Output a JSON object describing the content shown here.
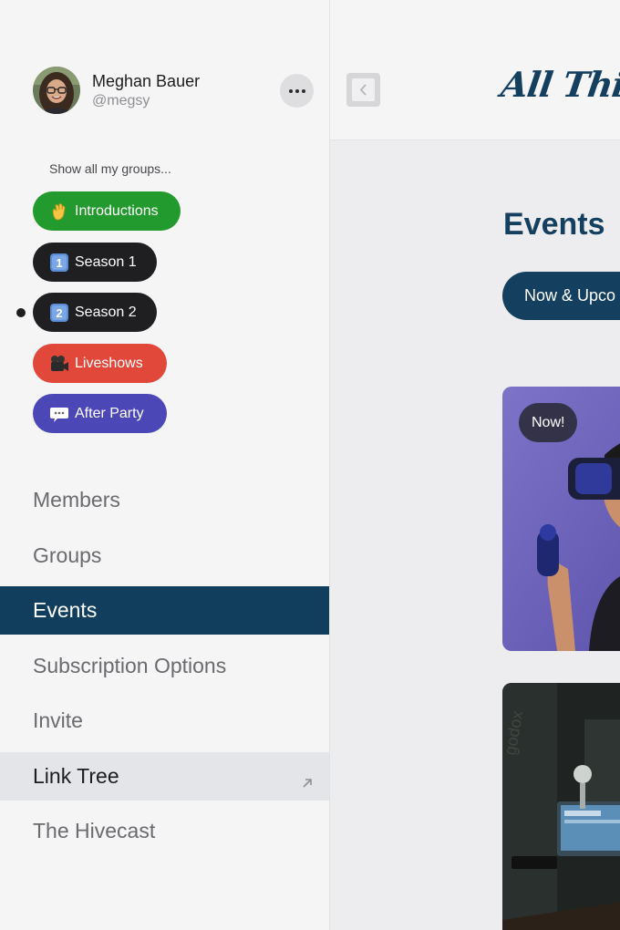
{
  "profile": {
    "name": "Meghan Bauer",
    "handle": "@megsy"
  },
  "groups": {
    "show_all_label": "Show all my groups...",
    "items": [
      {
        "label": "Introductions",
        "icon": "waving-hand-icon",
        "color": "#229a2d"
      },
      {
        "label": "Season 1",
        "icon": "keycap-1-icon",
        "color": "#1f1f22"
      },
      {
        "label": "Season 2",
        "icon": "keycap-2-icon",
        "color": "#1f1f22",
        "selected": true
      },
      {
        "label": "Liveshows",
        "icon": "video-camera-icon",
        "color": "#e2483a"
      },
      {
        "label": "After Party",
        "icon": "speech-bubble-icon",
        "color": "#4b47b6"
      }
    ]
  },
  "nav": {
    "items": [
      {
        "label": "Members"
      },
      {
        "label": "Groups"
      },
      {
        "label": "Events",
        "active": true
      },
      {
        "label": "Subscription Options"
      },
      {
        "label": "Invite"
      },
      {
        "label": "Link Tree",
        "external": true
      },
      {
        "label": "The Hivecast"
      }
    ]
  },
  "header": {
    "logo_text": "All Things P"
  },
  "main": {
    "title": "Events",
    "filter_label": "Now & Upco",
    "cards": [
      {
        "badge": "Now!",
        "image": "vr-headset-person"
      },
      {
        "image": "podcast-studio-microphone"
      }
    ]
  },
  "colors": {
    "accent": "#143f5f",
    "sidebar_bg": "#f5f5f6",
    "main_bg": "#ededef"
  }
}
